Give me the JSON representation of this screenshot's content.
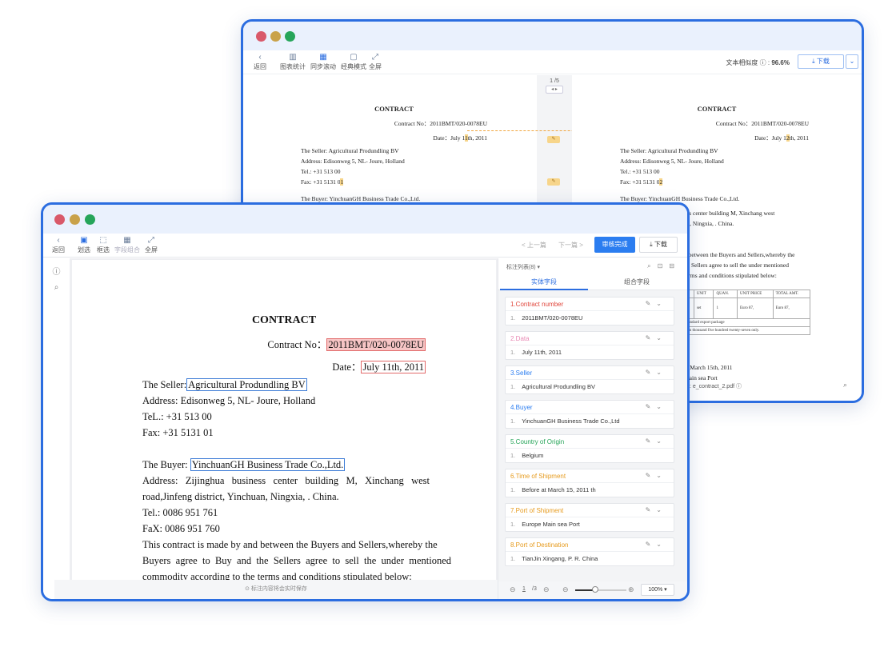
{
  "back_window": {
    "toolbar": {
      "back": "返回",
      "chart_stats": "图表统计",
      "sync_scroll": "同步滚动",
      "classic_mode": "经典模式",
      "fullscreen": "全屏",
      "similarity_label": "文本相似度 ⓘ : ",
      "similarity_value": "96.6%",
      "download": "下载"
    },
    "page_indicator": "1 /5",
    "left_doc": {
      "title": "CONTRACT",
      "contract_no": "Contract No：2011BMT/020-0078EU",
      "date_prefix": "Date：July 1",
      "date_hl": "1",
      "date_suffix": "th, 2011",
      "seller": "The Seller: Agricultural Produndling BV",
      "address": "Address: Edisonweg 5, NL- Joure, Holland",
      "tel": "Tel.: +31 513 00",
      "fax_prefix": "Fax: +31 5131 0",
      "fax_hl": "1",
      "buyer_partial": "The Buyer: YinchuanGH Business Trade Co.,Ltd."
    },
    "right_doc": {
      "title": "CONTRACT",
      "contract_no": "Contract No：2011BMT/020-0078EU",
      "date_prefix": "Date：July 1",
      "date_hl": "2",
      "date_suffix": "th, 2011",
      "seller": "The Seller: Agricultural Produndling BV",
      "address": "Address: Edisonweg 5, NL- Joure, Holland",
      "tel": "Tel.: +31 513 00",
      "fax_prefix": "Fax: +31 5131 0",
      "fax_hl": "2",
      "buyer": "The Buyer: YinchuanGH Business Trade Co.,Ltd.",
      "line1": "ess center building M, Xinchang west",
      "line2": "an, Ningxia, . China.",
      "line3": "d between the Buyers and Sellers,whereby the",
      "line4": "he Sellers agree to sell the under mentioned",
      "line5": "terms and conditions stipulated below:",
      "table_headers": [
        "N",
        "UNIT",
        "QUAN.",
        "UNIT PRICE",
        "TOTAL AMT."
      ],
      "table_row": [
        "",
        "set",
        "1",
        "Euro 87,",
        "Euro 87,"
      ],
      "table_note1": "standard export package",
      "table_note2": "ven thousand five hundred twenty-seven only.",
      "line6": "m",
      "line7": "at March 15th, 2011",
      "line8": "Main sea Port",
      "footer_file": "档: e_contract_2.pdf ⓘ"
    }
  },
  "front_window": {
    "toolbar": {
      "back": "返回",
      "select": "划选",
      "box_select": "框选",
      "field_combo": "字段组合",
      "fullscreen": "全屏",
      "prev": "< 上一篇",
      "next": "下一篇 >",
      "review_done": "审核完成",
      "download": "下载"
    },
    "doc": {
      "title": "CONTRACT",
      "contract_no_label": "Contract No：",
      "contract_no": "2011BMT/020-0078EU",
      "date_label": "Date：",
      "date": "July 11th, 2011",
      "seller_label": "The Seller:",
      "seller": "Agricultural Produndling BV",
      "address": "Address: Edisonweg 5, NL- Joure, Holland",
      "tel": "TeL.: +31 513 00",
      "fax": "Fax: +31 5131 01",
      "buyer_label": "The Buyer:",
      "buyer": "YinchuanGH Business Trade Co.,Ltd.",
      "buyer_address_1": "Address:   Zijinghua   business   center   building   M,   Xinchang   west",
      "buyer_address_2": "road,Jinfeng district, Yinchuan, Ningxia, . China.",
      "buyer_tel": "Tel.: 0086 951 761",
      "buyer_fax": "FaX: 0086 951 760",
      "para_1": "This contract is made by and between the Buyers and Sellers,whereby the",
      "para_2": "Buyers  agree  to  Buy  and  the  Sellers  agree  to  sell  the  under  mentioned",
      "para_3": "commodity according to the terms and conditions stipulated below:",
      "footer_note": "⊙ 标注内容将会实时保存"
    },
    "panel": {
      "list_title": "标注列表(8) ▾",
      "tab_entity": "实体字段",
      "tab_combo": "组合字段",
      "cards": [
        {
          "title": "1.Contract number",
          "value": "2011BMT/020-0078EU",
          "color": "#e0453a"
        },
        {
          "title": "2.Data",
          "value": "July 11th, 2011",
          "color": "#e889b4"
        },
        {
          "title": "3.Seller",
          "value": "Agricultural Produndling BV",
          "color": "#2b7df0"
        },
        {
          "title": "4.Buyer",
          "value": "YinchuanGH Business Trade Co.,Ltd",
          "color": "#2b7df0"
        },
        {
          "title": "5.Country of Origin",
          "value": "Belgium",
          "color": "#27a55a"
        },
        {
          "title": "6.Time of Shipment",
          "value": "Before at March 15, 2011 th",
          "color": "#e69a1c"
        },
        {
          "title": "7.Port of Shipment",
          "value": "Europe Main sea Port",
          "color": "#e69a1c"
        },
        {
          "title": "8.Port of Destination",
          "value": "TianJin Xingang, P. R. China",
          "color": "#e69a1c"
        }
      ],
      "item_index": "1.",
      "page_current": "1",
      "page_total": "/3",
      "zoom": "100%"
    }
  }
}
